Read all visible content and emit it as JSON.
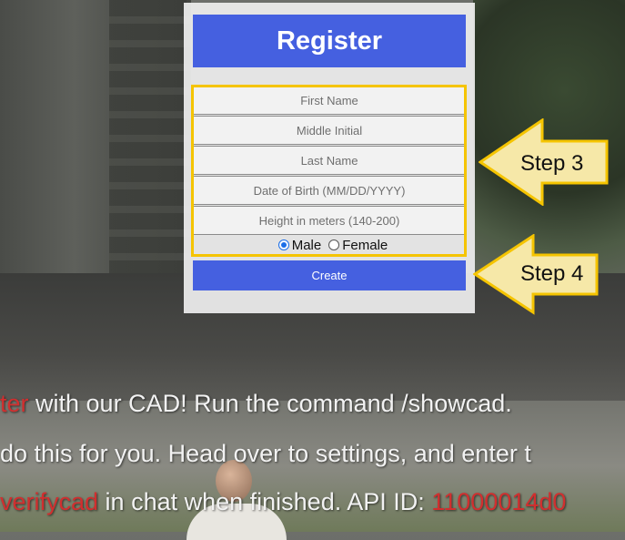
{
  "form": {
    "title": "Register",
    "fields": [
      {
        "placeholder": "First Name"
      },
      {
        "placeholder": "Middle Initial"
      },
      {
        "placeholder": "Last Name"
      },
      {
        "placeholder": "Date of Birth (MM/DD/YYYY)"
      },
      {
        "placeholder": "Height in meters (140-200)"
      }
    ],
    "gender": {
      "options": [
        "Male",
        "Female"
      ],
      "selected": "Male"
    },
    "create_label": "Create"
  },
  "steps": {
    "step3": "Step 3",
    "step4": "Step 4"
  },
  "chat": {
    "line1": {
      "red": "ter",
      "text": " with our CAD! Run the command /showcad."
    },
    "line2": {
      "text": " do this for you. Head over to settings, and enter t"
    },
    "line3": {
      "red": "verifycad",
      "text": " in chat when finished. API ID: ",
      "red2": "11000014d0"
    }
  },
  "colors": {
    "accent": "#4560e0",
    "highlight": "#f5c400",
    "arrow_fill": "#f6e8a8",
    "chat_red": "#d12f2f"
  }
}
